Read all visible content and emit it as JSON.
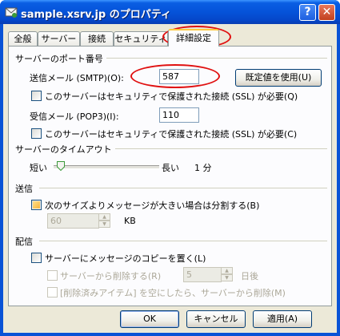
{
  "window": {
    "title": "sample.xsrv.jp のプロパティ",
    "help_label": "?",
    "close_label": "✕"
  },
  "tabs": [
    "全般",
    "サーバー",
    "接続",
    "セキュリティ",
    "詳細設定"
  ],
  "active_tab": "詳細設定",
  "ports": {
    "section_title": "サーバーのポート番号",
    "smtp_label": "送信メール (SMTP)(O):",
    "smtp_value": "587",
    "default_button": "既定値を使用(U)",
    "smtp_ssl_label": "このサーバーはセキュリティで保護された接続 (SSL) が必要(Q)",
    "smtp_ssl_checked": false,
    "pop3_label": "受信メール (POP3)(I):",
    "pop3_value": "110",
    "pop3_ssl_label": "このサーバーはセキュリティで保護された接続 (SSL) が必要(C)",
    "pop3_ssl_checked": false
  },
  "timeout": {
    "section_title": "サーバーのタイムアウト",
    "short_label": "短い",
    "long_label": "長い",
    "value_label": "1 分",
    "slider_level": 0.05
  },
  "sending": {
    "section_title": "送信",
    "split_label": "次のサイズよりメッセージが大きい場合は分割する(B)",
    "split_checked": false,
    "split_size": "60",
    "kb_label": "KB"
  },
  "delivery": {
    "section_title": "配信",
    "keep_copy_label": "サーバーにメッセージのコピーを置く(L)",
    "keep_copy_checked": false,
    "remove_after_label": "サーバーから削除する(R)",
    "remove_after_days": "5",
    "days_label": "日後",
    "remove_deleted_label": "[削除済みアイテム] を空にしたら、サーバーから削除(M)"
  },
  "buttons": {
    "ok": "OK",
    "cancel": "キャンセル",
    "apply": "適用(A)"
  },
  "colors": {
    "title_bar": "#0553d9",
    "dialog_bg": "#ece9d8",
    "annotation": "#e01010"
  }
}
